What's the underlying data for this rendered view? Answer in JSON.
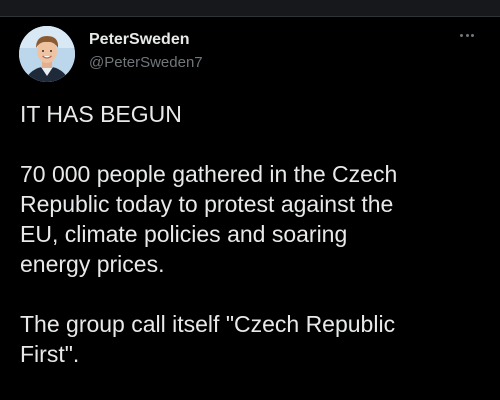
{
  "tweet": {
    "author": {
      "display_name": "PeterSweden",
      "handle": "@PeterSweden7"
    },
    "more_icon": "more-horizontal-icon",
    "paragraphs": [
      "IT HAS BEGUN",
      "70 000 people gathered in the Czech\nRepublic today to protest against the\nEU, climate policies and soaring\nenergy prices.",
      "The group call itself \"Czech Republic\nFirst\"."
    ]
  },
  "colors": {
    "background": "#000000",
    "text_primary": "#e7e9ea",
    "text_secondary": "#71767b"
  }
}
